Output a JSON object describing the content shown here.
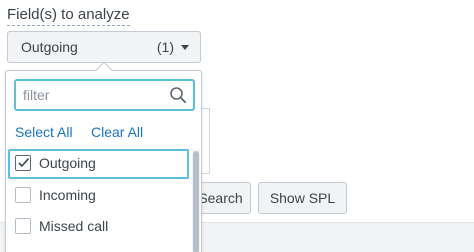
{
  "field_label": "Field(s) to analyze",
  "select": {
    "value": "Outgoing",
    "count": "(1)",
    "caret_icon": "caret-down-icon"
  },
  "popover": {
    "filter": {
      "placeholder": "filter",
      "value": "",
      "icon": "search-icon"
    },
    "select_all_label": "Select All",
    "clear_all_label": "Clear All",
    "options": [
      {
        "label": "Outgoing",
        "checked": true
      },
      {
        "label": "Incoming",
        "checked": false
      },
      {
        "label": "Missed call",
        "checked": false
      }
    ]
  },
  "background": {
    "search_button_label": "Search",
    "show_spl_button_label": "Show SPL"
  },
  "colors": {
    "focus_ring": "#5bc0de",
    "link": "#1a74c5",
    "text": "#3c444d",
    "button_bg": "#f1f3f4"
  }
}
